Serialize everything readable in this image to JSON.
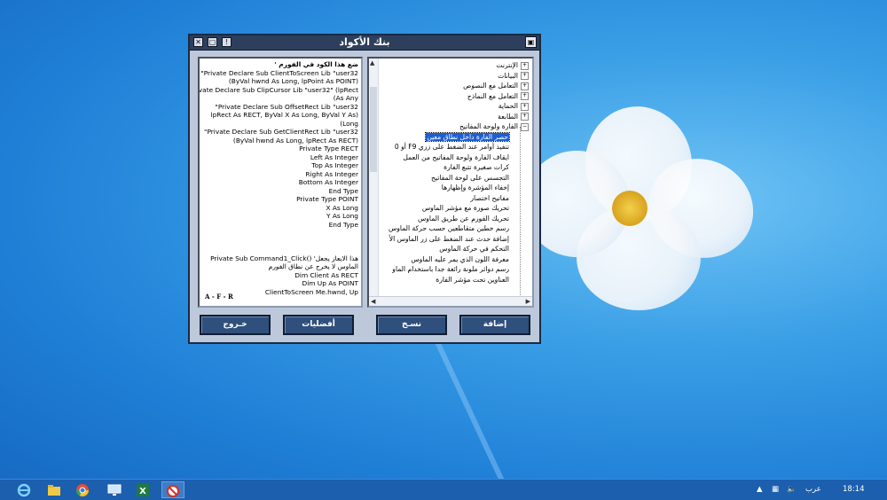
{
  "window": {
    "title": "بنك الأكواد",
    "controls": [
      "close-icon",
      "restore-icon",
      "pin-icon"
    ],
    "app_icon": "app-icon"
  },
  "code": {
    "lines": [
      "ضع هذا الكود في الفورم '",
      "Private Declare Sub ClientToScreen Lib \"user32\"",
      "(ByVal hwnd As Long, lpPoint As POINT)",
      "Private Declare Sub ClipCursor Lib \"user32\" (lpRect",
      "As Any)",
      "Private Declare Sub OffsetRect Lib \"user32\"",
      "(lpRect As RECT, ByVal X As Long, ByVal Y As",
      "Long)",
      "Private Declare Sub GetClientRect Lib \"user32\"",
      "(ByVal hwnd As Long, lpRect As RECT)",
      "Private Type RECT",
      "Left As Integer",
      "Top As Integer",
      "Right As Integer",
      "Bottom As Integer",
      "End Type",
      "Private Type POINT",
      "X As Long",
      "Y As Long",
      "End Type",
      "",
      "",
      "",
      "هذا الايعاز يجعل' ()Private Sub Command1_Click",
      "الماوس لا يخرج عن نطاق الفورم",
      "Dim Client As RECT",
      "Dim Up As POINT",
      "ClientToScreen Me.hwnd, Up"
    ],
    "signature": "A - F - R"
  },
  "tree": {
    "top_items": [
      "الإنترنت",
      "البيانات",
      "التعامل مع النصوص",
      "التعامل مع النماذج",
      "الحماية",
      "الطابعة",
      "الفارة ولوحة المفاتيح"
    ],
    "children": [
      "حصر الفارة داخل نطاق معين",
      "تنفيذ أوامر عند الضغط على زري F9 أو 0",
      "ايقاف الفارة ولوحة المفاتيح من العمل",
      "كرات صغيرة تتبع الفارة",
      "التجسس على لوحة المفاتيح",
      "إخفاء المؤشرة وإظهارها",
      "مفاتيح اختصار",
      "تحريك صورة مع مؤشر الماوس",
      "تحريك الفورم عن طريق الماوس",
      "رسم خطين متقاطعين حسب حركة الماوس",
      "إضافة حدث عند الضغط على زر الماوس الأ",
      "التحكم في حركة الماوس",
      "معرفة اللون الذي يمر عليه الماوس",
      "رسم دوائر ملونة رائعة جدا باستخدام الماو",
      "العناوين تحت مؤشر الفارة"
    ],
    "selected_index": 0
  },
  "buttons": {
    "add": "إضافة",
    "copy": "نسـخ",
    "favorites": "أفضليات",
    "exit": "خـروج"
  },
  "taskbar": {
    "apps": [
      "ie-icon",
      "file-explorer-icon",
      "chrome-icon",
      "remote-desktop-icon",
      "excel-icon",
      "code-bank-icon"
    ],
    "language": "عرب",
    "time": "18:14"
  }
}
